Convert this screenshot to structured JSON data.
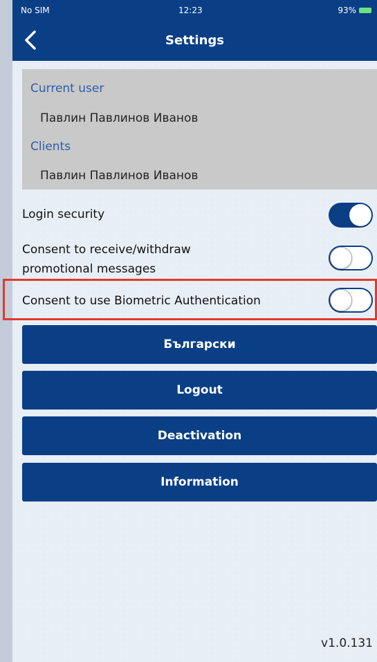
{
  "status_bar": {
    "carrier": "No SIM",
    "time": "12:23",
    "battery": "93%"
  },
  "header": {
    "title": "Settings",
    "back_icon": "chevron-left-icon"
  },
  "user_info": {
    "current_user_label": "Current user",
    "current_user_value": "Павлин Павлинов Иванов",
    "clients_label": "Clients",
    "clients_value": "Павлин Павлинов Иванов"
  },
  "toggles": [
    {
      "label": "Login security",
      "on": true
    },
    {
      "label_line1": "Consent to receive/withdraw",
      "label_line2": "promotional messages",
      "on": false
    },
    {
      "label": "Consent to use Biometric Authentication",
      "on": false
    }
  ],
  "buttons": {
    "language": "Български",
    "logout": "Logout",
    "deactivation": "Deactivation",
    "information": "Information"
  },
  "version": "v1.0.131",
  "colors": {
    "primary": "#0a3f86",
    "highlight": "#e2382d",
    "label_blue": "#2d5ea9"
  }
}
